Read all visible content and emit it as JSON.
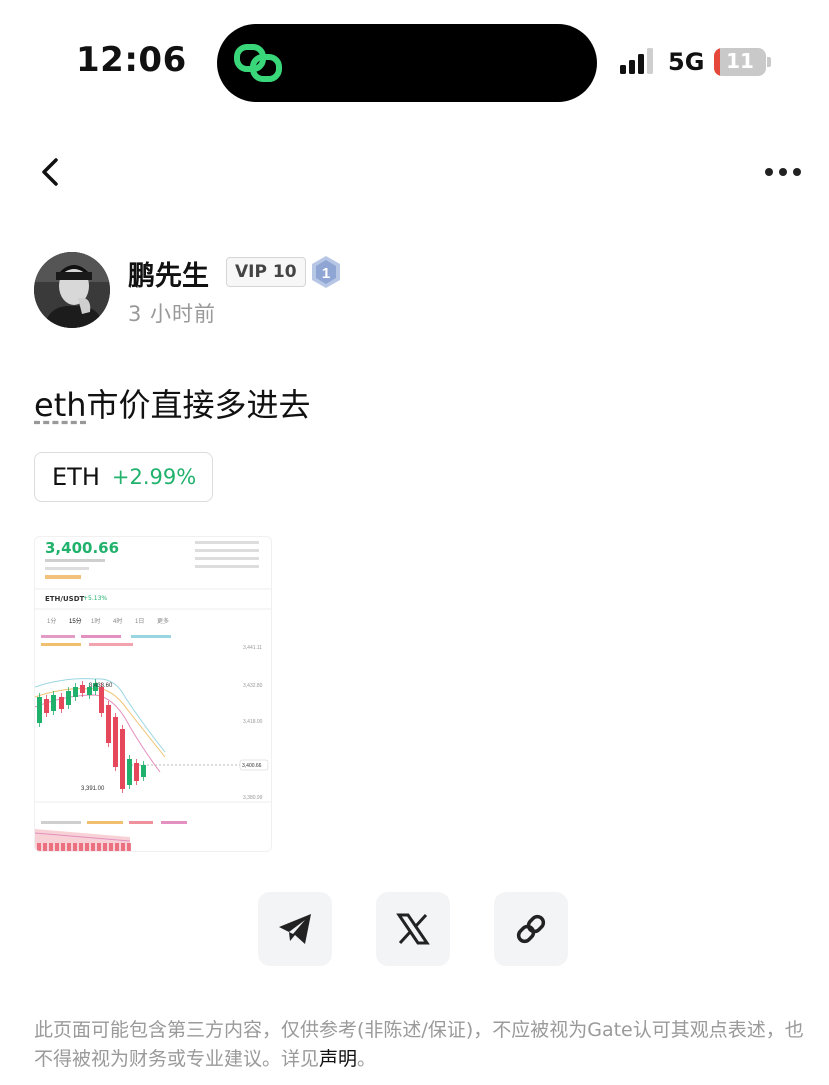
{
  "status_bar": {
    "time": "12:06",
    "network": "5G",
    "battery": "11",
    "battery_level": 0.11,
    "signal_bars": 3
  },
  "nav": {
    "back_icon": "chevron-left-icon",
    "more_icon": "more-horizontal-icon"
  },
  "author": {
    "name": "鹏先生",
    "vip_badge": "VIP 10",
    "level": "1",
    "post_time": "3 小时前"
  },
  "post": {
    "tag": "eth",
    "text": "市价直接多进去"
  },
  "ticker_chip": {
    "symbol": "ETH",
    "change": "+2.99%",
    "change_color": "#20b26c"
  },
  "chart_image": {
    "price": "3,400.66",
    "pair": "ETH/USDT",
    "pair_change": "+5.13%",
    "tabs": [
      "1分",
      "15分",
      "1时",
      "4时",
      "1日",
      "更多"
    ],
    "price_labels": [
      "3,433.60",
      "3,391.00",
      "3,400.66"
    ],
    "axis_labels": [
      "3,441.11",
      "3,432.80",
      "3,418.00",
      "3,400.66",
      "3,380.99"
    ],
    "up_color": "#20b26c",
    "down_color": "#e5485b"
  },
  "share": {
    "telegram_icon": "telegram-icon",
    "x_icon": "x-icon",
    "link_icon": "link-icon"
  },
  "disclaimer": {
    "text": "此页面可能包含第三方内容，仅供参考(非陈述/保证)，不应被视为Gate认可其观点表述，也不得被视为财务或专业建议。详见",
    "link": "声明",
    "end": "。"
  }
}
